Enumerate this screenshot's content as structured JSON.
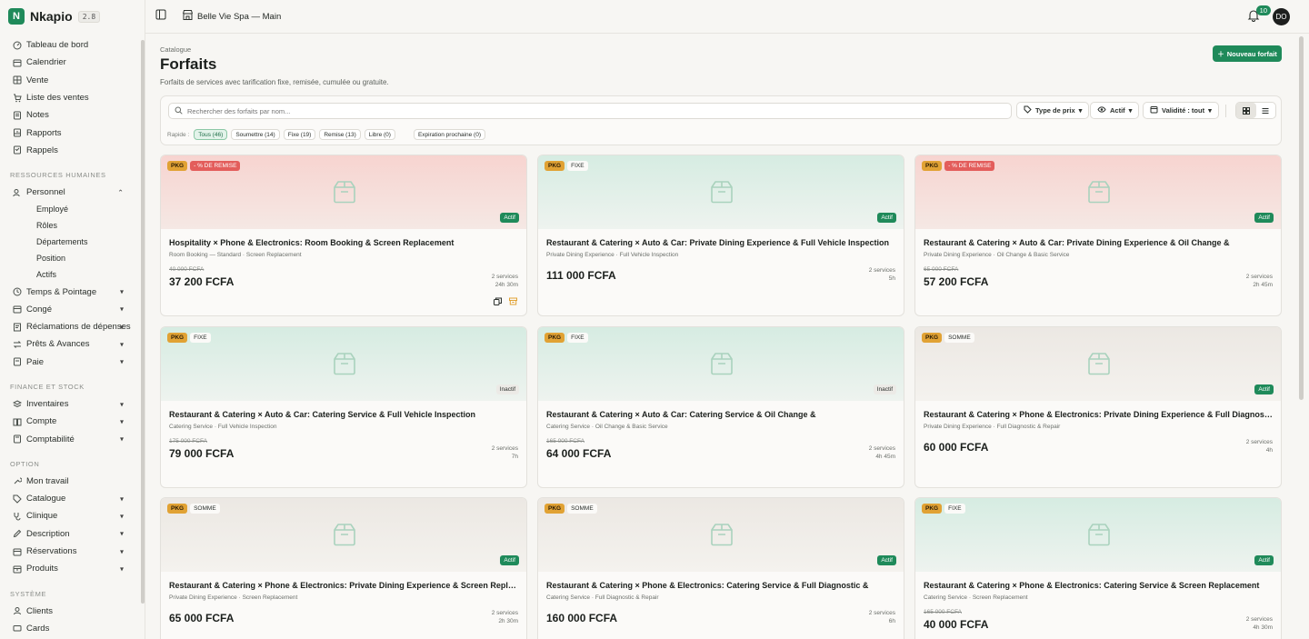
{
  "brand": {
    "name": "Nkapio",
    "version": "2.8"
  },
  "topbar": {
    "store": "Belle Vie Spa — Main",
    "notif_count": "10",
    "avatar": "DO"
  },
  "sidebar": {
    "main": [
      {
        "label": "Tableau de bord",
        "icon": "dashboard-icon"
      },
      {
        "label": "Calendrier",
        "icon": "calendar-icon"
      },
      {
        "label": "Vente",
        "icon": "grid-icon"
      },
      {
        "label": "Liste des ventes",
        "icon": "cart-icon"
      },
      {
        "label": "Notes",
        "icon": "notes-icon"
      },
      {
        "label": "Rapports",
        "icon": "reports-icon"
      },
      {
        "label": "Rappels",
        "icon": "reminder-icon"
      }
    ],
    "hr_section": "Ressources humaines",
    "personnel": "Personnel",
    "personnel_sub": [
      "Employé",
      "Rôles",
      "Départements",
      "Position",
      "Actifs"
    ],
    "hr_items": [
      "Temps & Pointage",
      "Congé",
      "Réclamations de dépenses",
      "Prêts & Avances",
      "Paie"
    ],
    "finance_section": "Finance et stock",
    "finance_items": [
      "Inventaires",
      "Compte",
      "Comptabilité"
    ],
    "option_section": "Option",
    "option_items": [
      "Mon travail",
      "Catalogue",
      "Clinique",
      "Description",
      "Réservations",
      "Produits"
    ],
    "system_section": "Système",
    "system_items": [
      "Clients",
      "Cards"
    ]
  },
  "header": {
    "breadcrumb": "Catalogue",
    "title": "Forfaits",
    "subtitle": "Forfaits de services avec tarification fixe, remisée, cumulée ou gratuite.",
    "new_button": "Nouveau forfait"
  },
  "filters": {
    "search_placeholder": "Rechercher des forfaits par nom...",
    "price_type": "Type de prix",
    "active": "Actif",
    "validity": "Validité : tout",
    "quick_label": "Rapide :",
    "chips": [
      "Tous (46)",
      "Soumettre (14)",
      "Fixe (19)",
      "Remise (13)",
      "Libre (0)"
    ],
    "chip_expiry": "Expiration prochaine (0)"
  },
  "cards": [
    {
      "pkg": "PKG",
      "kind": "- % DE REMISE",
      "status": "Actif",
      "name": "Hospitality × Phone & Electronics: Room Booking & Screen Replacement",
      "services": "Room Booking — Standard · Screen Replacement",
      "old_price": "40 000 FCFA",
      "price": "37 200 FCFA",
      "count": "2 services",
      "duration": "24h 30m"
    },
    {
      "pkg": "PKG",
      "kind": "FIXE",
      "status": "Actif",
      "name": "Restaurant & Catering × Auto & Car: Private Dining Experience & Full Vehicle Inspection",
      "services": "Private Dining Experience · Full Vehicle Inspection",
      "old_price": "",
      "price": "111 000 FCFA",
      "count": "2 services",
      "duration": "5h"
    },
    {
      "pkg": "PKG",
      "kind": "- % DE REMISE",
      "status": "Actif",
      "name": "Restaurant & Catering × Auto & Car: Private Dining Experience & Oil Change &",
      "services": "Private Dining Experience · Oil Change & Basic Service",
      "old_price": "65 000 FCFA",
      "price": "57 200 FCFA",
      "count": "2 services",
      "duration": "2h 45m"
    },
    {
      "pkg": "PKG",
      "kind": "FIXE",
      "status": "Inactif",
      "name": "Restaurant & Catering × Auto & Car: Catering Service & Full Vehicle Inspection",
      "services": "Catering Service · Full Vehicle Inspection",
      "old_price": "175 000 FCFA",
      "price": "79 000 FCFA",
      "count": "2 services",
      "duration": "7h"
    },
    {
      "pkg": "PKG",
      "kind": "FIXE",
      "status": "Inactif",
      "name": "Restaurant & Catering × Auto & Car: Catering Service & Oil Change &",
      "services": "Catering Service · Oil Change & Basic Service",
      "old_price": "165 000 FCFA",
      "price": "64 000 FCFA",
      "count": "2 services",
      "duration": "4h 45m"
    },
    {
      "pkg": "PKG",
      "kind": "SOMME",
      "status": "Actif",
      "name": "Restaurant & Catering × Phone & Electronics: Private Dining Experience & Full Diagnostic &",
      "services": "Private Dining Experience · Full Diagnostic & Repair",
      "old_price": "",
      "price": "60 000 FCFA",
      "count": "2 services",
      "duration": "4h"
    },
    {
      "pkg": "PKG",
      "kind": "SOMME",
      "status": "Actif",
      "name": "Restaurant & Catering × Phone & Electronics: Private Dining Experience & Screen Replacement",
      "services": "Private Dining Experience · Screen Replacement",
      "old_price": "",
      "price": "65 000 FCFA",
      "count": "2 services",
      "duration": "2h 30m"
    },
    {
      "pkg": "PKG",
      "kind": "SOMME",
      "status": "Actif",
      "name": "Restaurant & Catering × Phone & Electronics: Catering Service & Full Diagnostic &",
      "services": "Catering Service · Full Diagnostic & Repair",
      "old_price": "",
      "price": "160 000 FCFA",
      "count": "2 services",
      "duration": "6h"
    },
    {
      "pkg": "PKG",
      "kind": "FIXE",
      "status": "Actif",
      "name": "Restaurant & Catering × Phone & Electronics: Catering Service & Screen Replacement",
      "services": "Catering Service · Screen Replacement",
      "old_price": "165 000 FCFA",
      "price": "40 000 FCFA",
      "count": "2 services",
      "duration": "4h 30m"
    }
  ],
  "colors": {
    "accent": "#1f8a5a",
    "pkg": "#e1a234",
    "discount": "#e35d5b"
  }
}
